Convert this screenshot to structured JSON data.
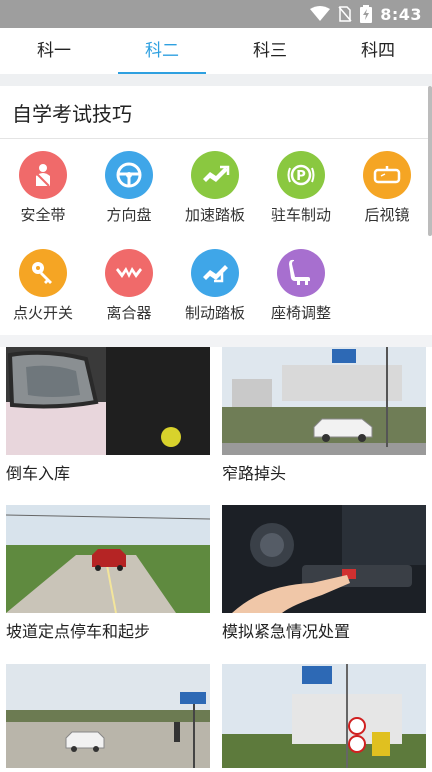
{
  "status": {
    "time": "8:43"
  },
  "tabs": [
    {
      "label": "科一",
      "active": false
    },
    {
      "label": "科二",
      "active": true
    },
    {
      "label": "科三",
      "active": false
    },
    {
      "label": "科四",
      "active": false
    }
  ],
  "section": {
    "title": "自学考试技巧"
  },
  "skills": [
    {
      "label": "安全带",
      "icon": "seatbelt-icon",
      "color": "#f06a6a"
    },
    {
      "label": "方向盘",
      "icon": "steering-wheel-icon",
      "color": "#3fa6e8"
    },
    {
      "label": "加速踏板",
      "icon": "accelerator-pedal-icon",
      "color": "#8ac840"
    },
    {
      "label": "驻车制动",
      "icon": "parking-brake-icon",
      "color": "#8ac840"
    },
    {
      "label": "后视镜",
      "icon": "rearview-mirror-icon",
      "color": "#f5a524"
    },
    {
      "label": "点火开关",
      "icon": "ignition-key-icon",
      "color": "#f5a524"
    },
    {
      "label": "离合器",
      "icon": "clutch-icon",
      "color": "#f06a6a"
    },
    {
      "label": "制动踏板",
      "icon": "brake-pedal-icon",
      "color": "#3fa6e8"
    },
    {
      "label": "座椅调整",
      "icon": "seat-adjust-icon",
      "color": "#a76fcf"
    }
  ],
  "lessons": [
    {
      "title": "倒车入库",
      "image": "side-mirror-photo"
    },
    {
      "title": "窄路掉头",
      "image": "narrow-road-car-photo"
    },
    {
      "title": "坡道定点停车和起步",
      "image": "slope-road-photo"
    },
    {
      "title": "模拟紧急情况处置",
      "image": "dashboard-button-photo"
    },
    {
      "title": "",
      "image": "test-track-photo"
    },
    {
      "title": "",
      "image": "road-sign-photo"
    }
  ]
}
